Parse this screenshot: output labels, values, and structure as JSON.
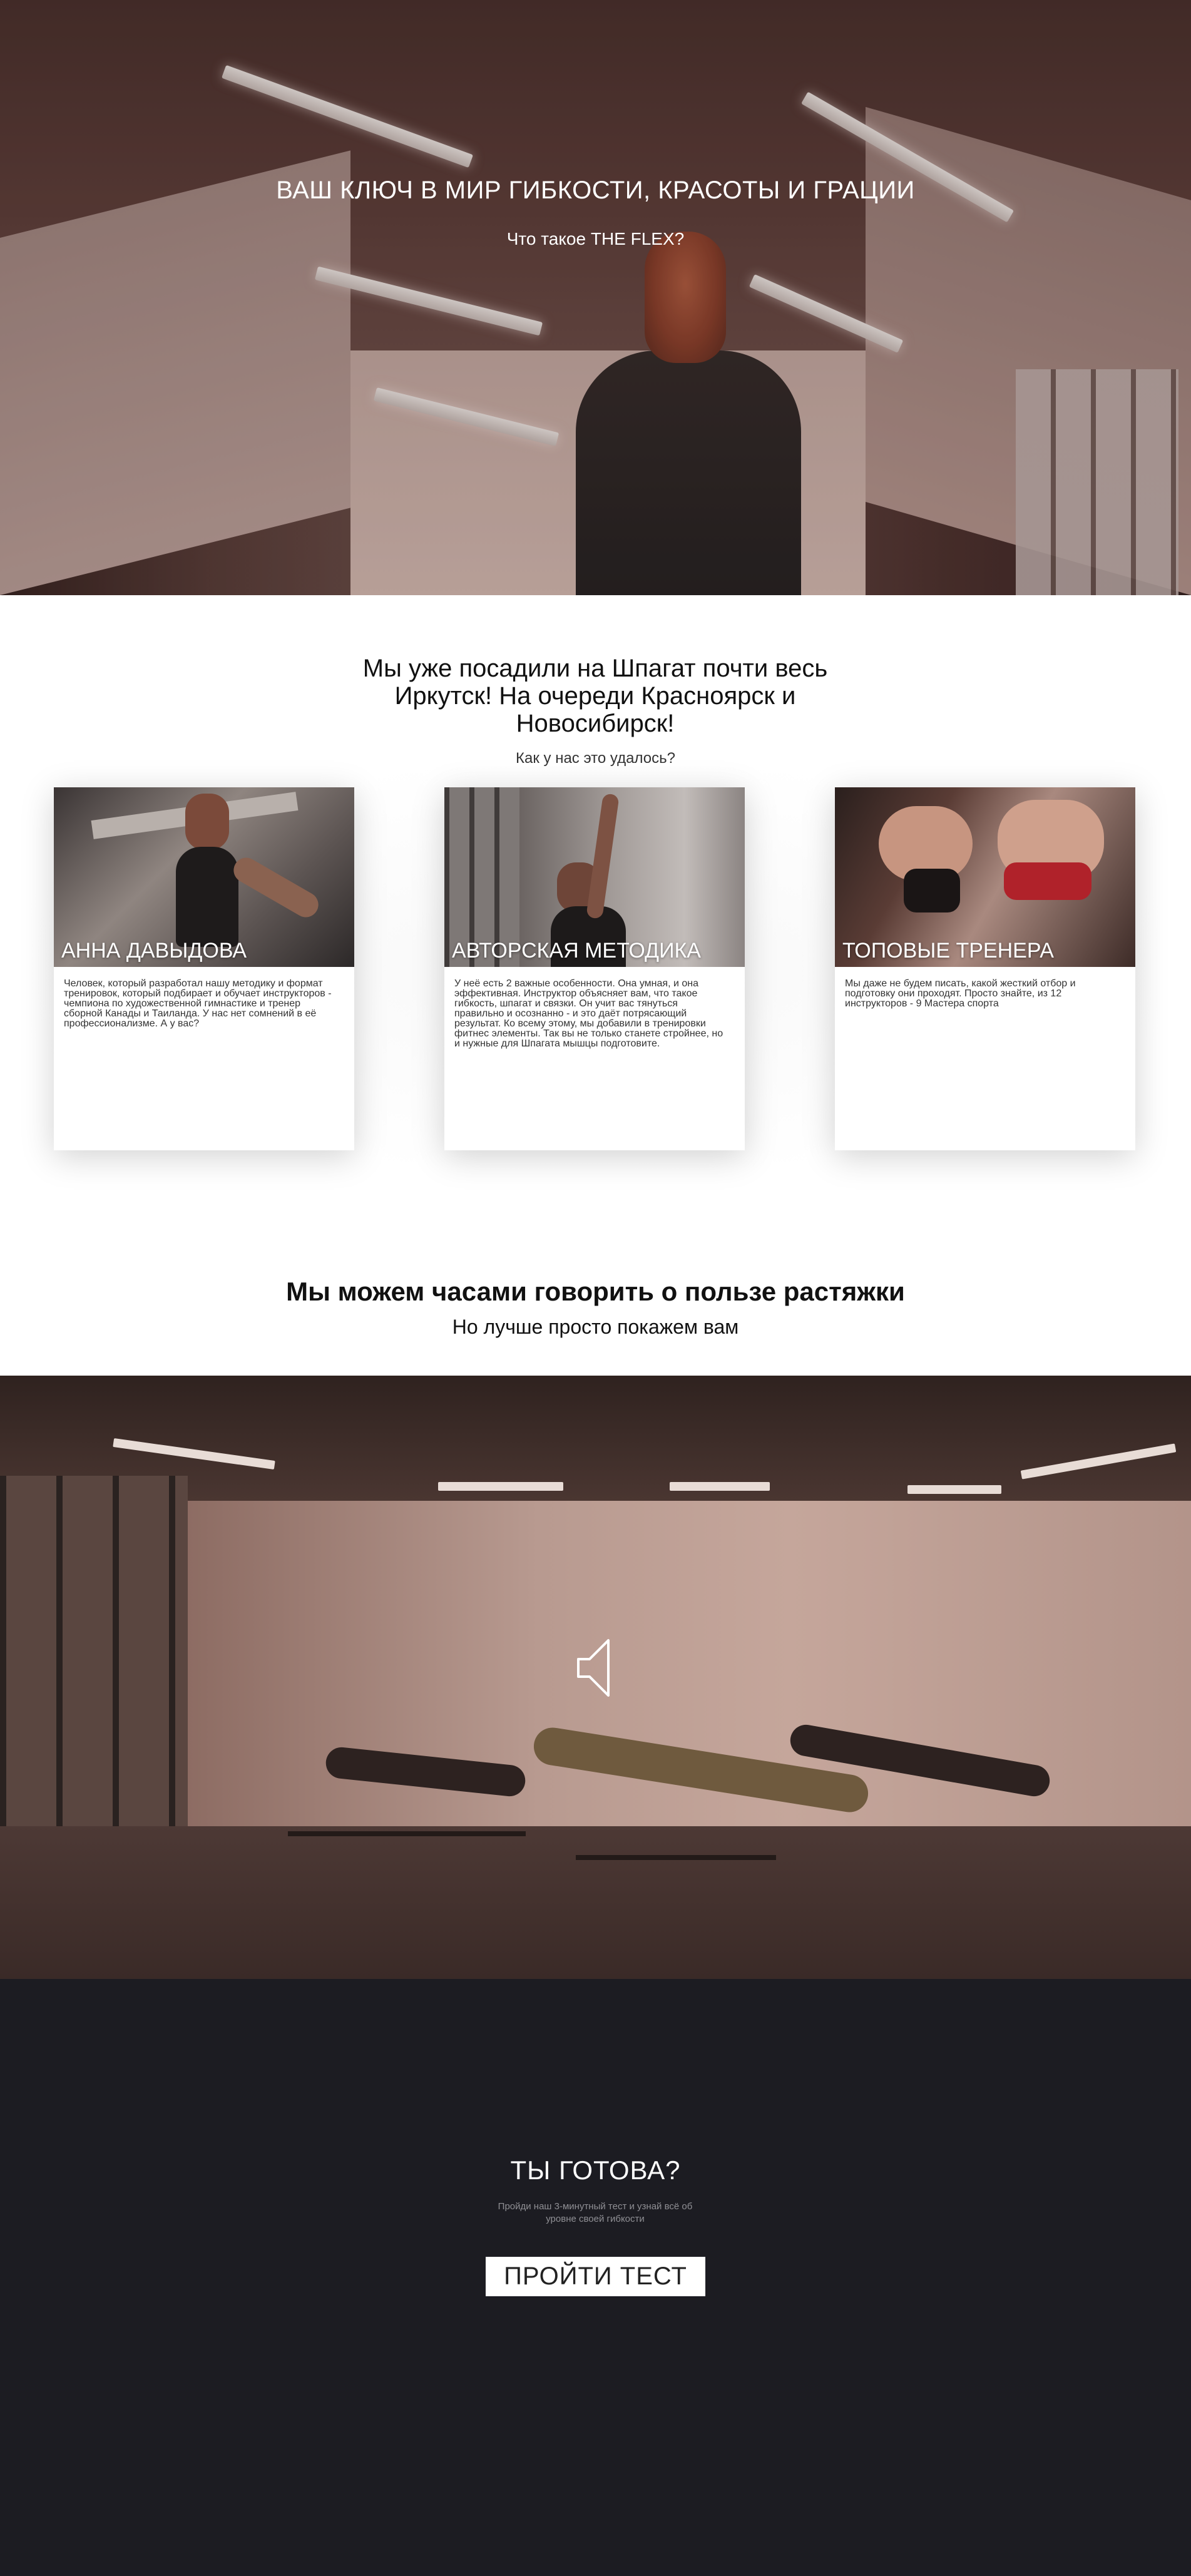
{
  "hero": {
    "title": "ВАШ КЛЮЧ В МИР ГИБКОСТИ, КРАСОТЫ И ГРАЦИИ",
    "subtitle": "Что такое THE FLEX?"
  },
  "about": {
    "title": "Мы уже посадили на Шпагат почти весь Иркутск! На очереди Красноярск и Новосибирск!",
    "subtitle": "Как у нас это удалось?",
    "cards": [
      {
        "title": "АННА ДАВЫДОВА",
        "text": "Человек, который разработал нашу методику и формат тренировок, который подбирает и обучает инструкторов - чемпиона по художественной гимнастике и тренер сборной Канады и Таиланда. У нас нет сомнений в её профессионализме. А у вас?"
      },
      {
        "title": "АВТОРСКАЯ МЕТОДИКА",
        "text": "У неё есть 2 важные особенности. Она умная, и она эффективная. Инструктор объясняет вам, что такое гибкость, шпагат и связки. Он учит вас тянуться правильно и осознанно - и это даёт потрясающий результат. Ко всему этому, мы добавили в тренировки фитнес элементы. Так вы не только станете стройнее, но и нужные для Шпагата мышцы подготовите."
      },
      {
        "title": "ТОПОВЫЕ ТРЕНЕРА",
        "text": "Мы даже не будем писать, какой жесткий отбор и подготовку они проходят. Просто знайте, из 12 инструкторов - 9 Мастера спорта"
      }
    ]
  },
  "stretch": {
    "title": "Мы можем часами говорить о пользе растяжки",
    "subtitle": "Но лучше просто покажем вам"
  },
  "video": {
    "mute_icon": "speaker-muted-icon"
  },
  "cta": {
    "title": "ТЫ ГОТОВА?",
    "subtitle": "Пройди наш 3-минутный тест и узнай всё об уровне своей гибкости",
    "button_label": "ПРОЙТИ ТЕСТ"
  },
  "colors": {
    "dark_bg": "#1c1c22",
    "white": "#ffffff",
    "muted_text": "#8f8f94"
  }
}
